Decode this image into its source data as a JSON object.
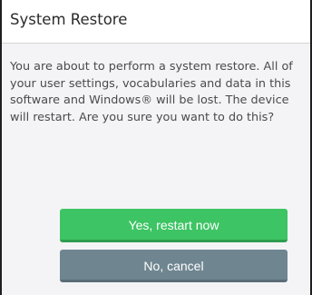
{
  "dialog": {
    "title": "System Restore",
    "message": "You are about to perform a system restore. All of your user settings, vocabularies and data in this software and Windows® will be lost. The device will restart. Are you sure you want to do this?",
    "confirm_label": "Yes, restart now",
    "cancel_label": "No, cancel"
  },
  "colors": {
    "confirm": "#3dc464",
    "cancel": "#6f8691",
    "background": "#f4f4f6"
  }
}
